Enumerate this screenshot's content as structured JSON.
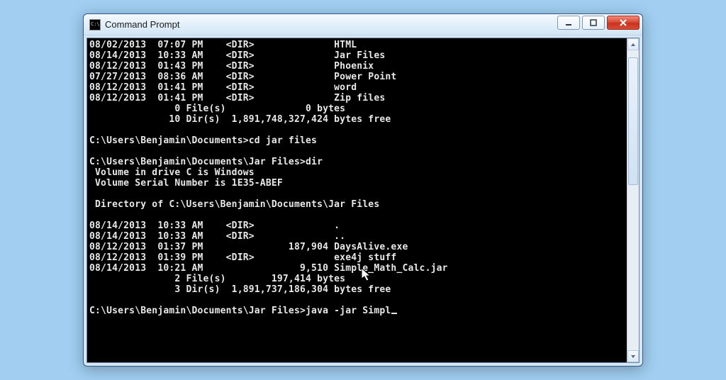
{
  "titlebar": {
    "icon_text": "C:\\",
    "title": "Command Prompt"
  },
  "terminal": {
    "listing1": [
      {
        "date": "08/02/2013",
        "time": "07:07 PM",
        "dir": "<DIR>",
        "size": "",
        "name": "HTML"
      },
      {
        "date": "08/14/2013",
        "time": "10:33 AM",
        "dir": "<DIR>",
        "size": "",
        "name": "Jar Files"
      },
      {
        "date": "08/12/2013",
        "time": "01:43 PM",
        "dir": "<DIR>",
        "size": "",
        "name": "Phoenix"
      },
      {
        "date": "07/27/2013",
        "time": "08:36 AM",
        "dir": "<DIR>",
        "size": "",
        "name": "Power Point"
      },
      {
        "date": "08/12/2013",
        "time": "01:41 PM",
        "dir": "<DIR>",
        "size": "",
        "name": "word"
      },
      {
        "date": "08/12/2013",
        "time": "01:41 PM",
        "dir": "<DIR>",
        "size": "",
        "name": "Zip files"
      }
    ],
    "summary1_files": "               0 File(s)              0 bytes",
    "summary1_dirs": "              10 Dir(s)  1,891,748,327,424 bytes free",
    "prompt1": "C:\\Users\\Benjamin\\Documents>",
    "cmd1": "cd jar files",
    "prompt2": "C:\\Users\\Benjamin\\Documents\\Jar Files>",
    "cmd2": "dir",
    "vol_line": " Volume in drive C is Windows",
    "serial_line": " Volume Serial Number is 1E35-ABEF",
    "dir_of_line": " Directory of C:\\Users\\Benjamin\\Documents\\Jar Files",
    "listing2": [
      {
        "date": "08/14/2013",
        "time": "10:33 AM",
        "dir": "<DIR>",
        "size": "",
        "name": "."
      },
      {
        "date": "08/14/2013",
        "time": "10:33 AM",
        "dir": "<DIR>",
        "size": "",
        "name": ".."
      },
      {
        "date": "08/12/2013",
        "time": "01:37 PM",
        "dir": "",
        "size": "187,904",
        "name": "DaysAlive.exe"
      },
      {
        "date": "08/12/2013",
        "time": "01:39 PM",
        "dir": "<DIR>",
        "size": "",
        "name": "exe4j stuff"
      },
      {
        "date": "08/14/2013",
        "time": "10:21 AM",
        "dir": "",
        "size": "9,510",
        "name": "Simple_Math_Calc.jar"
      }
    ],
    "summary2_files": "               2 File(s)        197,414 bytes",
    "summary2_dirs": "               3 Dir(s)  1,891,737,186,304 bytes free",
    "prompt3": "C:\\Users\\Benjamin\\Documents\\Jar Files>",
    "cmd3": "java -jar Simpl"
  }
}
